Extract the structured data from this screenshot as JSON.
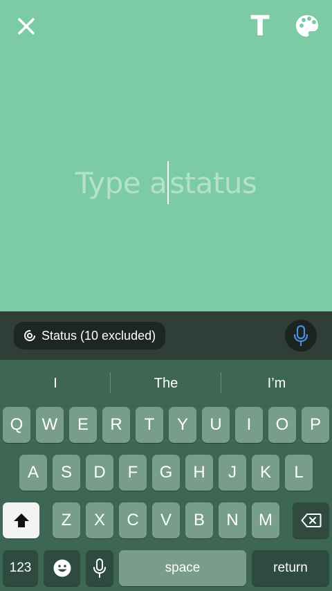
{
  "canvas": {
    "background": "#7ccba4",
    "placeholder_before": "Type a",
    "placeholder_after": "status",
    "icons": {
      "close": "close-icon",
      "text_style": "T",
      "palette": "palette-icon"
    }
  },
  "audience_bar": {
    "label": "Status (10 excluded)",
    "mic_icon": "microphone-icon"
  },
  "keyboard": {
    "suggestions": [
      "I",
      "The",
      "I’m"
    ],
    "rows": [
      [
        "Q",
        "W",
        "E",
        "R",
        "T",
        "Y",
        "U",
        "I",
        "O",
        "P"
      ],
      [
        "A",
        "S",
        "D",
        "F",
        "G",
        "H",
        "J",
        "K",
        "L"
      ],
      [
        "Z",
        "X",
        "C",
        "V",
        "B",
        "N",
        "M"
      ]
    ],
    "numbers_label": "123",
    "space_label": "space",
    "return_label": "return",
    "shift_icon": "shift-icon",
    "delete_icon": "delete-icon",
    "emoji_icon": "emoji-icon",
    "dictation_icon": "microphone-icon"
  }
}
